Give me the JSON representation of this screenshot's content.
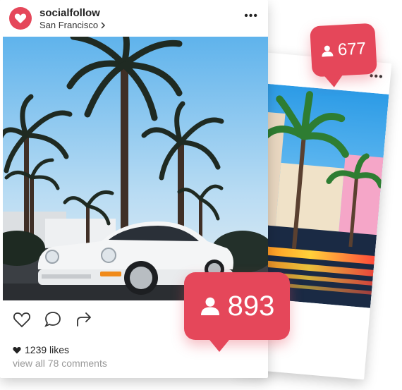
{
  "post": {
    "username": "socialfollow",
    "location": "San Francisco",
    "likes": "1239 likes",
    "comments": "view all 78 comments"
  },
  "bubbles": {
    "front_count": "893",
    "back_count": "677"
  },
  "colors": {
    "accent": "#e5475a",
    "sky": "#8ec7f0",
    "car": "#f3f3f3"
  },
  "icons": {
    "avatar": "heart-icon",
    "actions": [
      "like-icon",
      "comment-icon",
      "share-icon"
    ],
    "more": "more-icon",
    "user": "user-icon"
  }
}
